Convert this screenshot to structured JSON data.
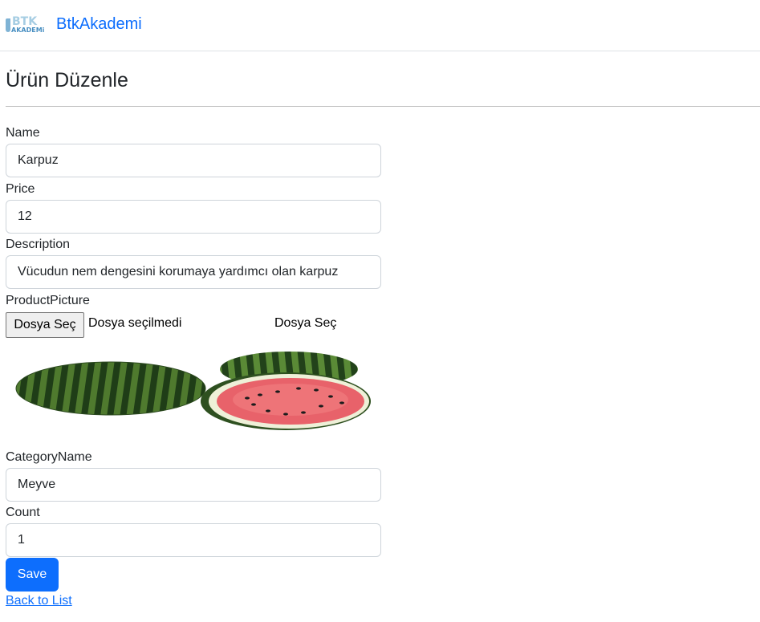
{
  "navbar": {
    "logo": {
      "top": "BTK",
      "bottom": "AKADEMi"
    },
    "brand": "BtkAkademi"
  },
  "page": {
    "title": "Ürün Düzenle"
  },
  "form": {
    "name": {
      "label": "Name",
      "value": "Karpuz"
    },
    "price": {
      "label": "Price",
      "value": "12"
    },
    "description": {
      "label": "Description",
      "value": "Vücudun nem dengesini korumaya yardımcı olan karpuz"
    },
    "picture": {
      "label": "ProductPicture",
      "button": "Dosya Seç",
      "status": "Dosya seçilmedi",
      "hint": "Dosya Seç"
    },
    "category": {
      "label": "CategoryName",
      "value": "Meyve"
    },
    "count": {
      "label": "Count",
      "value": "1"
    },
    "save": "Save",
    "back": "Back to List"
  },
  "colors": {
    "primary": "#0d6efd",
    "text": "#212529",
    "border": "#ced4da"
  },
  "icons": {
    "logo": "btk-akademi-logo",
    "picture": "watermelon-image"
  }
}
